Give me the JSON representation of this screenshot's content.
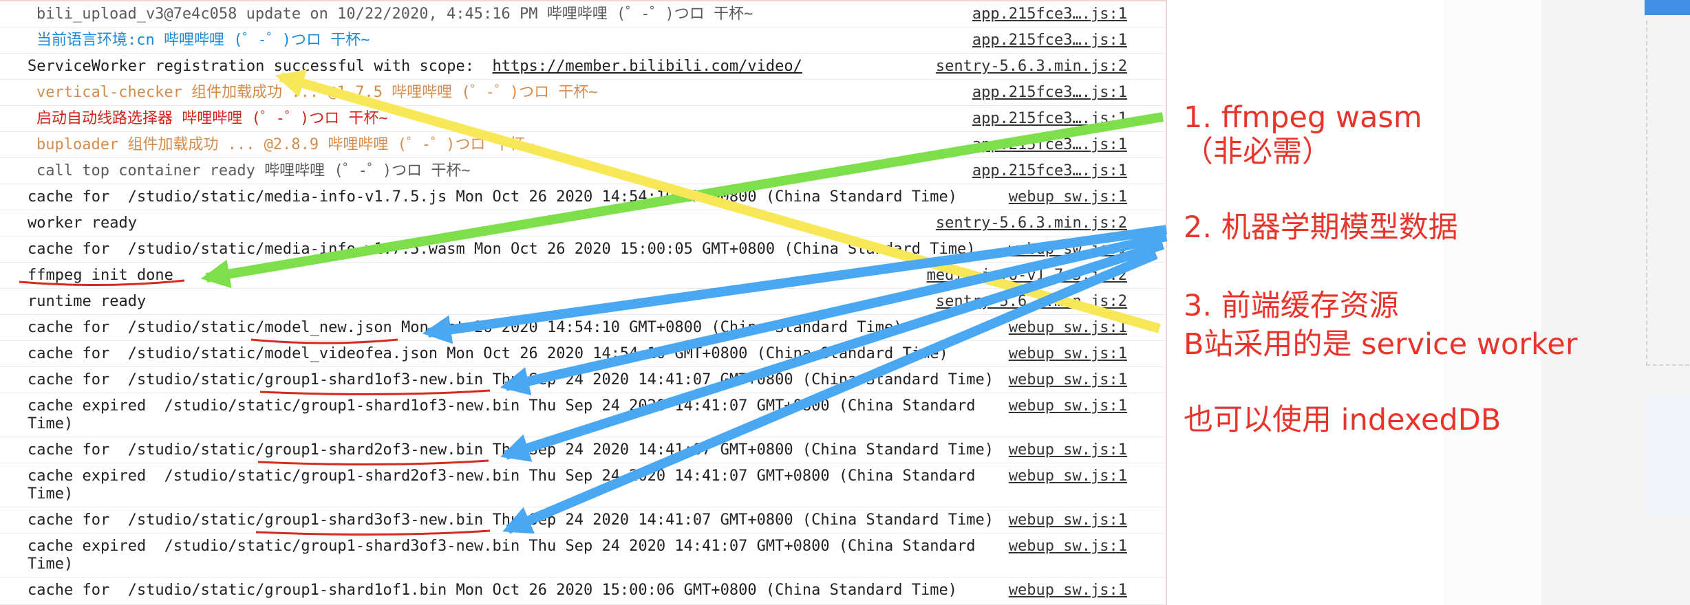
{
  "console": {
    "rows": [
      {
        "text": "bili_upload_v3@7e4c058 update on 10/22/2020, 4:45:16 PM 哔哩哔哩 (゜-゜)つロ 干杯~",
        "source": "app.215fce3….js:1",
        "color": "gray",
        "indent": true
      },
      {
        "text": "当前语言环境:cn 哔哩哔哩 (゜-゜)つロ 干杯~",
        "source": "app.215fce3….js:1",
        "color": "blue",
        "indent": true
      },
      {
        "text_before": "ServiceWorker registration successful with scope:  ",
        "link": "https://member.bilibili.com/video/",
        "source": "sentry-5.6.3.min.js:2",
        "color": "dark",
        "indent": false
      },
      {
        "text": "vertical-checker 组件加载成功 ... @1.7.5 哔哩哔哩 (゜-゜)つロ 干杯~",
        "source": "app.215fce3….js:1",
        "color": "orange",
        "indent": true
      },
      {
        "text": "启动自动线路选择器 哔哩哔哩 (゜-゜)つロ 干杯~",
        "source": "app.215fce3….js:1",
        "color": "red",
        "indent": true
      },
      {
        "text": "buploader 组件加载成功 ... @2.8.9 哔哩哔哩 (゜-゜)つロ 干杯~",
        "source": "app.215fce3….js:1",
        "color": "orange",
        "indent": true
      },
      {
        "text": "call top container ready 哔哩哔哩 (゜-゜)つロ 干杯~",
        "source": "app.215fce3….js:1",
        "color": "gray",
        "indent": true
      },
      {
        "text": "cache for  /studio/static/media-info-v1.7.5.js Mon Oct 26 2020 14:54:10 GMT+0800 (China Standard Time)",
        "source": "webup sw.js:1",
        "color": "dark",
        "indent": false
      },
      {
        "text": "worker ready",
        "source": "sentry-5.6.3.min.js:2",
        "color": "dark",
        "indent": false
      },
      {
        "text": "cache for  /studio/static/media-info-v1.7.5.wasm Mon Oct 26 2020 15:00:05 GMT+0800 (China Standard Time)",
        "source": "webup sw.js:1",
        "color": "dark",
        "indent": false
      },
      {
        "text": "ffmpeg init done",
        "source": "media-info-v1.7.5.js:2",
        "color": "dark",
        "indent": false
      },
      {
        "text": "runtime ready",
        "source": "sentry-5.6.3.min.js:2",
        "color": "dark",
        "indent": false
      },
      {
        "text": "cache for  /studio/static/model_new.json Mon Oct 26 2020 14:54:10 GMT+0800 (China Standard Time)",
        "source": "webup sw.js:1",
        "color": "dark",
        "indent": false
      },
      {
        "text": "cache for  /studio/static/model_videofea.json Mon Oct 26 2020 14:54:10 GMT+0800 (China Standard Time)",
        "source": "webup sw.js:1",
        "color": "dark",
        "indent": false
      },
      {
        "text": "cache for  /studio/static/group1-shard1of3-new.bin Thu Sep 24 2020 14:41:07 GMT+0800 (China Standard Time)",
        "source": "webup sw.js:1",
        "color": "dark",
        "indent": false
      },
      {
        "text": "cache expired  /studio/static/group1-shard1of3-new.bin Thu Sep 24 2020 14:41:07 GMT+0800 (China Standard Time)",
        "source": "webup sw.js:1",
        "color": "dark",
        "indent": false
      },
      {
        "text": "cache for  /studio/static/group1-shard2of3-new.bin Thu Sep 24 2020 14:41:07 GMT+0800 (China Standard Time)",
        "source": "webup sw.js:1",
        "color": "dark",
        "indent": false
      },
      {
        "text": "cache expired  /studio/static/group1-shard2of3-new.bin Thu Sep 24 2020 14:41:07 GMT+0800 (China Standard Time)",
        "source": "webup sw.js:1",
        "color": "dark",
        "indent": false
      },
      {
        "text": "cache for  /studio/static/group1-shard3of3-new.bin Thu Sep 24 2020 14:41:07 GMT+0800 (China Standard Time)",
        "source": "webup sw.js:1",
        "color": "dark",
        "indent": false
      },
      {
        "text": "cache expired  /studio/static/group1-shard3of3-new.bin Thu Sep 24 2020 14:41:07 GMT+0800 (China Standard Time)",
        "source": "webup sw.js:1",
        "color": "dark",
        "indent": false
      },
      {
        "text": "cache for  /studio/static/group1-shard1of1.bin Mon Oct 26 2020 15:00:06 GMT+0800 (China Standard Time)",
        "source": "webup sw.js:1",
        "color": "dark",
        "indent": false
      }
    ]
  },
  "annotations": {
    "item1_line1": "1. ffmpeg wasm",
    "item1_line2": "（非必需）",
    "item2": "2. 机器学期模型数据",
    "item3_line1": "3. 前端缓存资源",
    "item3_line2": "B站采用的是 service worker",
    "item4": "也可以使用 indexedDB"
  },
  "colors": {
    "annotation_text": "#e8352b",
    "arrow_green": "#7de04a",
    "arrow_yellow": "#f8e858",
    "arrow_blue": "#4aa8f2",
    "underline_red": "#d62b1f",
    "log_blue": "#1f8ad8",
    "log_orange": "#d58b4a",
    "log_red": "#d2231b"
  }
}
